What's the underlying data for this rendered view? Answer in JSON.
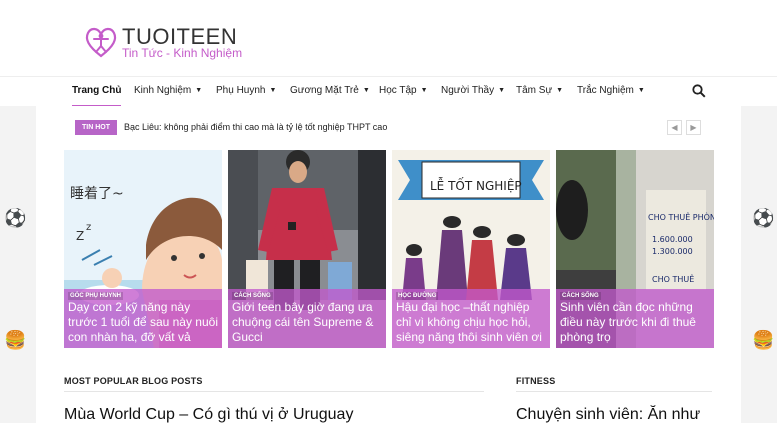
{
  "site": {
    "logo_title": "TUOITEEN",
    "logo_subtitle": "Tin Tức - Kinh Nghiệm",
    "brand_color": "#c45cc9"
  },
  "nav": {
    "items": [
      {
        "label": "Trang Chủ",
        "active": true
      },
      {
        "label": "Kinh Nghiệm"
      },
      {
        "label": "Phụ Huynh"
      },
      {
        "label": "Gương Mặt Trẻ"
      },
      {
        "label": "Học Tập"
      },
      {
        "label": "Người Thầy"
      },
      {
        "label": "Tâm Sự"
      },
      {
        "label": "Trắc Nghiệm"
      }
    ],
    "search_icon": "search-icon"
  },
  "ticker": {
    "badge": "TIN HOT",
    "text": "Bạc Liêu: không phải điểm thi cao mà là tỷ lệ tốt nghiệp THPT cao",
    "prev_icon": "chevron-left-icon",
    "next_icon": "chevron-right-icon"
  },
  "featured": [
    {
      "category": "GÓC PHỤ HUYNH",
      "title": "Dạy con 2 kỹ năng này trước 1 tuổi để sau này nuôi con nhàn ha, đỡ vất vả"
    },
    {
      "category": "CÁCH SỐNG",
      "title": "Giới teen bây giờ đang ưa chuộng cái tên Supreme & Gucci"
    },
    {
      "category": "HỌC ĐƯỜNG",
      "title": "Hậu đại học –thất nghiệp chỉ vì không chịu học hỏi, siêng năng thôi sinh viên ơi"
    },
    {
      "category": "CÁCH SỐNG",
      "title": "Sinh viên cần đọc những điều này trước khi đi thuê phòng trọ"
    }
  ],
  "sections": {
    "popular_label": "MOST POPULAR BLOG POSTS",
    "popular_first_title": "Mùa World Cup – Có gì thú vị ở Uruguay",
    "fitness_label": "FITNESS",
    "fitness_first_title": "Chuyện sinh viên: Ăn như"
  },
  "image_texts": {
    "card1_sign": "睡着了~",
    "card3_banner": "LỄ TỐT NGHIỆP",
    "card4_sign1": "CHO THUÊ PHÒNG",
    "card4_sign2": "CHO THUÊ"
  }
}
